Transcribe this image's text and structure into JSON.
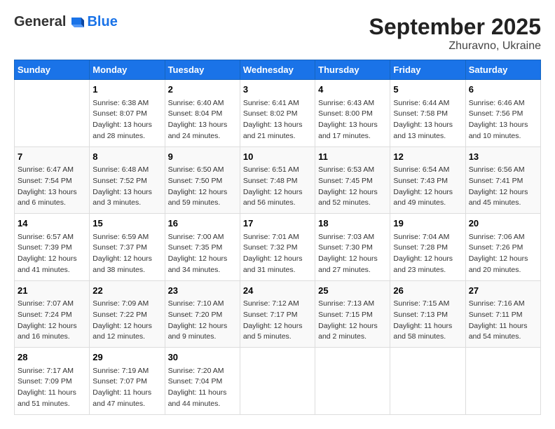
{
  "logo": {
    "general": "General",
    "blue": "Blue"
  },
  "title": "September 2025",
  "location": "Zhuravno, Ukraine",
  "days_of_week": [
    "Sunday",
    "Monday",
    "Tuesday",
    "Wednesday",
    "Thursday",
    "Friday",
    "Saturday"
  ],
  "weeks": [
    [
      {
        "day": "",
        "info": ""
      },
      {
        "day": "1",
        "info": "Sunrise: 6:38 AM\nSunset: 8:07 PM\nDaylight: 13 hours\nand 28 minutes."
      },
      {
        "day": "2",
        "info": "Sunrise: 6:40 AM\nSunset: 8:04 PM\nDaylight: 13 hours\nand 24 minutes."
      },
      {
        "day": "3",
        "info": "Sunrise: 6:41 AM\nSunset: 8:02 PM\nDaylight: 13 hours\nand 21 minutes."
      },
      {
        "day": "4",
        "info": "Sunrise: 6:43 AM\nSunset: 8:00 PM\nDaylight: 13 hours\nand 17 minutes."
      },
      {
        "day": "5",
        "info": "Sunrise: 6:44 AM\nSunset: 7:58 PM\nDaylight: 13 hours\nand 13 minutes."
      },
      {
        "day": "6",
        "info": "Sunrise: 6:46 AM\nSunset: 7:56 PM\nDaylight: 13 hours\nand 10 minutes."
      }
    ],
    [
      {
        "day": "7",
        "info": "Sunrise: 6:47 AM\nSunset: 7:54 PM\nDaylight: 13 hours\nand 6 minutes."
      },
      {
        "day": "8",
        "info": "Sunrise: 6:48 AM\nSunset: 7:52 PM\nDaylight: 13 hours\nand 3 minutes."
      },
      {
        "day": "9",
        "info": "Sunrise: 6:50 AM\nSunset: 7:50 PM\nDaylight: 12 hours\nand 59 minutes."
      },
      {
        "day": "10",
        "info": "Sunrise: 6:51 AM\nSunset: 7:48 PM\nDaylight: 12 hours\nand 56 minutes."
      },
      {
        "day": "11",
        "info": "Sunrise: 6:53 AM\nSunset: 7:45 PM\nDaylight: 12 hours\nand 52 minutes."
      },
      {
        "day": "12",
        "info": "Sunrise: 6:54 AM\nSunset: 7:43 PM\nDaylight: 12 hours\nand 49 minutes."
      },
      {
        "day": "13",
        "info": "Sunrise: 6:56 AM\nSunset: 7:41 PM\nDaylight: 12 hours\nand 45 minutes."
      }
    ],
    [
      {
        "day": "14",
        "info": "Sunrise: 6:57 AM\nSunset: 7:39 PM\nDaylight: 12 hours\nand 41 minutes."
      },
      {
        "day": "15",
        "info": "Sunrise: 6:59 AM\nSunset: 7:37 PM\nDaylight: 12 hours\nand 38 minutes."
      },
      {
        "day": "16",
        "info": "Sunrise: 7:00 AM\nSunset: 7:35 PM\nDaylight: 12 hours\nand 34 minutes."
      },
      {
        "day": "17",
        "info": "Sunrise: 7:01 AM\nSunset: 7:32 PM\nDaylight: 12 hours\nand 31 minutes."
      },
      {
        "day": "18",
        "info": "Sunrise: 7:03 AM\nSunset: 7:30 PM\nDaylight: 12 hours\nand 27 minutes."
      },
      {
        "day": "19",
        "info": "Sunrise: 7:04 AM\nSunset: 7:28 PM\nDaylight: 12 hours\nand 23 minutes."
      },
      {
        "day": "20",
        "info": "Sunrise: 7:06 AM\nSunset: 7:26 PM\nDaylight: 12 hours\nand 20 minutes."
      }
    ],
    [
      {
        "day": "21",
        "info": "Sunrise: 7:07 AM\nSunset: 7:24 PM\nDaylight: 12 hours\nand 16 minutes."
      },
      {
        "day": "22",
        "info": "Sunrise: 7:09 AM\nSunset: 7:22 PM\nDaylight: 12 hours\nand 12 minutes."
      },
      {
        "day": "23",
        "info": "Sunrise: 7:10 AM\nSunset: 7:20 PM\nDaylight: 12 hours\nand 9 minutes."
      },
      {
        "day": "24",
        "info": "Sunrise: 7:12 AM\nSunset: 7:17 PM\nDaylight: 12 hours\nand 5 minutes."
      },
      {
        "day": "25",
        "info": "Sunrise: 7:13 AM\nSunset: 7:15 PM\nDaylight: 12 hours\nand 2 minutes."
      },
      {
        "day": "26",
        "info": "Sunrise: 7:15 AM\nSunset: 7:13 PM\nDaylight: 11 hours\nand 58 minutes."
      },
      {
        "day": "27",
        "info": "Sunrise: 7:16 AM\nSunset: 7:11 PM\nDaylight: 11 hours\nand 54 minutes."
      }
    ],
    [
      {
        "day": "28",
        "info": "Sunrise: 7:17 AM\nSunset: 7:09 PM\nDaylight: 11 hours\nand 51 minutes."
      },
      {
        "day": "29",
        "info": "Sunrise: 7:19 AM\nSunset: 7:07 PM\nDaylight: 11 hours\nand 47 minutes."
      },
      {
        "day": "30",
        "info": "Sunrise: 7:20 AM\nSunset: 7:04 PM\nDaylight: 11 hours\nand 44 minutes."
      },
      {
        "day": "",
        "info": ""
      },
      {
        "day": "",
        "info": ""
      },
      {
        "day": "",
        "info": ""
      },
      {
        "day": "",
        "info": ""
      }
    ]
  ]
}
